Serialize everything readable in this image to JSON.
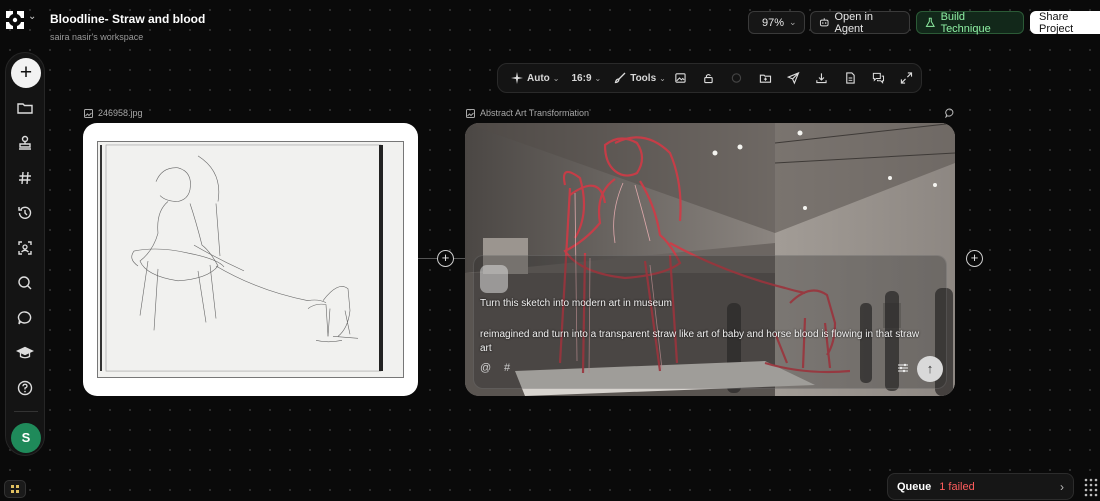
{
  "header": {
    "project_title": "Bloodline- Straw and blood",
    "workspace": "saira nasir's workspace",
    "zoom": "97%",
    "open_agent": "Open in Agent",
    "build_technique": "Build Technique",
    "share": "Share Project"
  },
  "sidebar": {
    "items": [
      {
        "icon": "folder-icon"
      },
      {
        "icon": "stamp-icon"
      },
      {
        "icon": "hashtag-icon"
      },
      {
        "icon": "history-icon"
      },
      {
        "icon": "scan-icon"
      },
      {
        "icon": "search-icon"
      },
      {
        "icon": "chat-icon"
      },
      {
        "icon": "graduation-cap-icon"
      },
      {
        "icon": "help-icon"
      }
    ],
    "avatar_initial": "S"
  },
  "toolbar": {
    "mode": "Auto",
    "ratio": "16:9",
    "tools": "Tools"
  },
  "nodes": {
    "source": {
      "label": "246958.jpg"
    },
    "output": {
      "label": "Abstract Art Transformation",
      "prompt_line1": "Turn this sketch  into modern art in museum",
      "prompt_line2": " reimagined and turn into a transparent straw like art of baby and horse blood is flowing in that straw art",
      "at_symbol": "@",
      "hash_symbol": "#"
    }
  },
  "queue": {
    "label": "Queue",
    "status": "1 failed"
  },
  "colors": {
    "accent_green": "#8ff0a4",
    "failed_red": "#ff5d5d",
    "avatar_green": "#1f8a5a"
  }
}
